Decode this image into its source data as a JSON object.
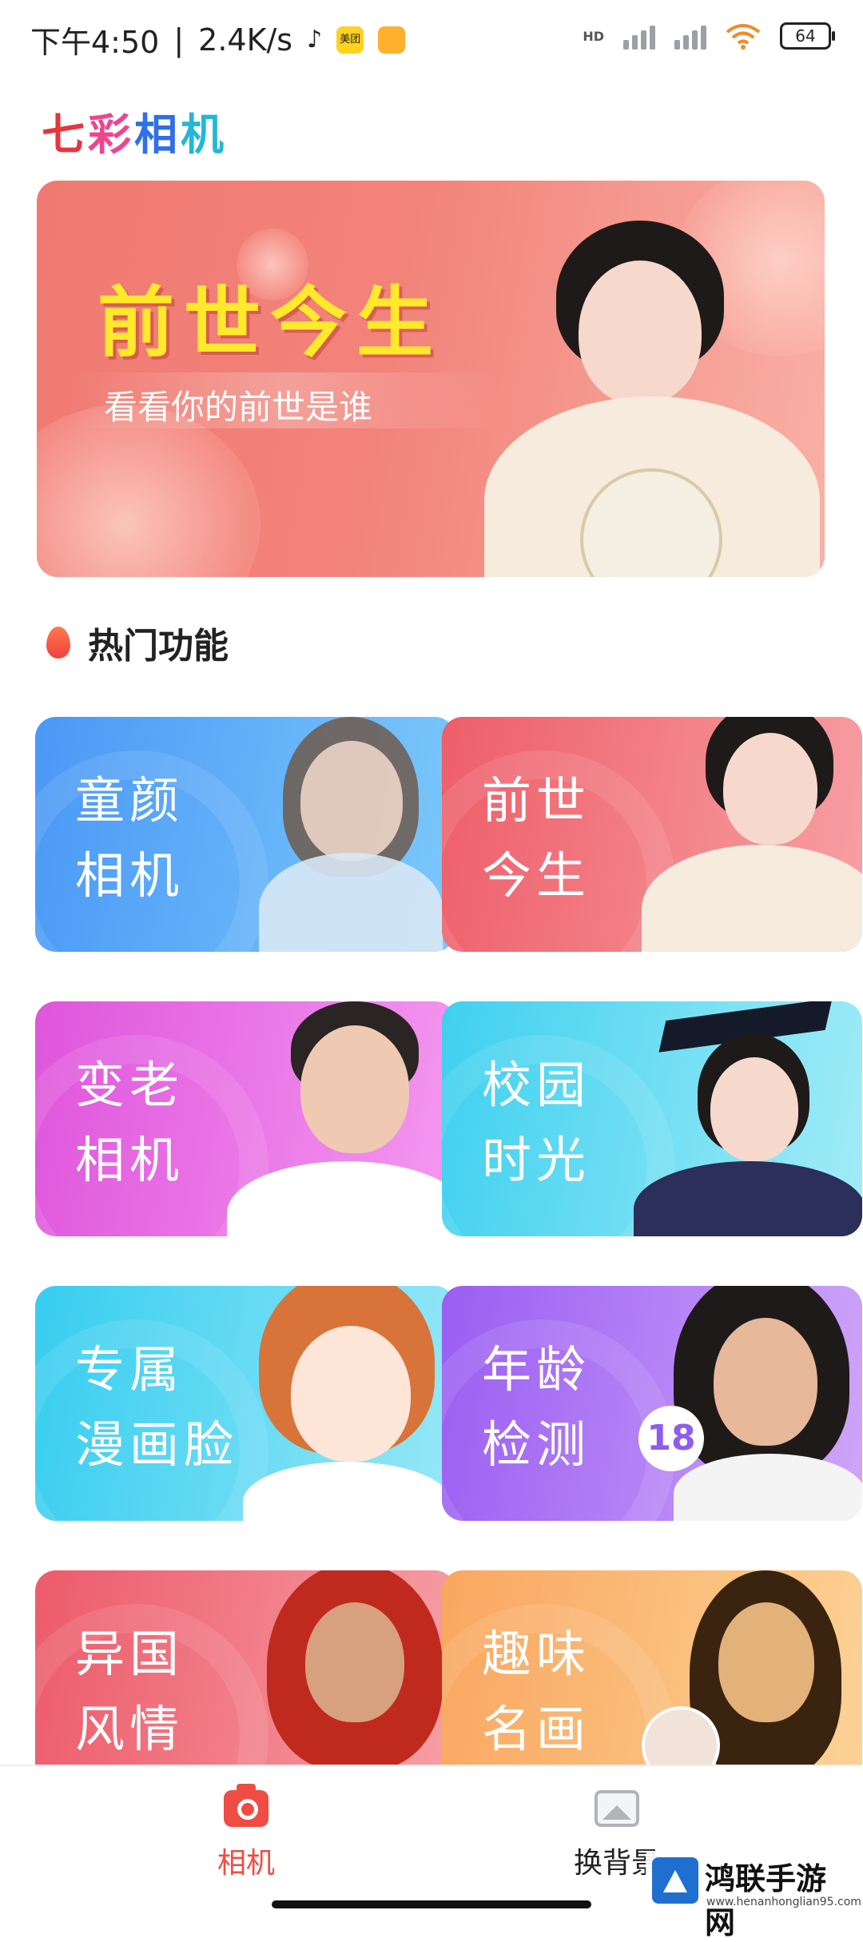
{
  "status_bar": {
    "time": "下午4:50",
    "net_speed": "2.4K/s",
    "meituan_label": "美团",
    "hd_label": "HD",
    "battery": "64"
  },
  "app": {
    "title_chars": [
      "七",
      "彩",
      "相",
      "机"
    ],
    "title_colors": [
      "#e8343b",
      "#f0448f",
      "#2f6fe8",
      "#22b7d6"
    ]
  },
  "banner": {
    "title": "前世今生",
    "subtitle": "看看你的前世是谁"
  },
  "section": {
    "title": "热门功能"
  },
  "features": [
    {
      "line1": "童颜",
      "line2": "相机"
    },
    {
      "line1": "前世",
      "line2": "今生"
    },
    {
      "line1": "变老",
      "line2": "相机"
    },
    {
      "line1": "校园",
      "line2": "时光"
    },
    {
      "line1": "专属",
      "line2": "漫画脸"
    },
    {
      "line1": "年龄",
      "line2": "检测",
      "badge": "18"
    },
    {
      "line1": "异国",
      "line2": "风情"
    },
    {
      "line1": "趣味",
      "line2": "名画"
    }
  ],
  "bottom_nav": {
    "camera_label": "相机",
    "background_label": "换背景"
  },
  "watermark": {
    "name": "鸿联手游网",
    "url": "www.henanhonglian95.com"
  },
  "colors": {
    "accent": "#ef4c43",
    "banner_title": "#ffe92d"
  }
}
